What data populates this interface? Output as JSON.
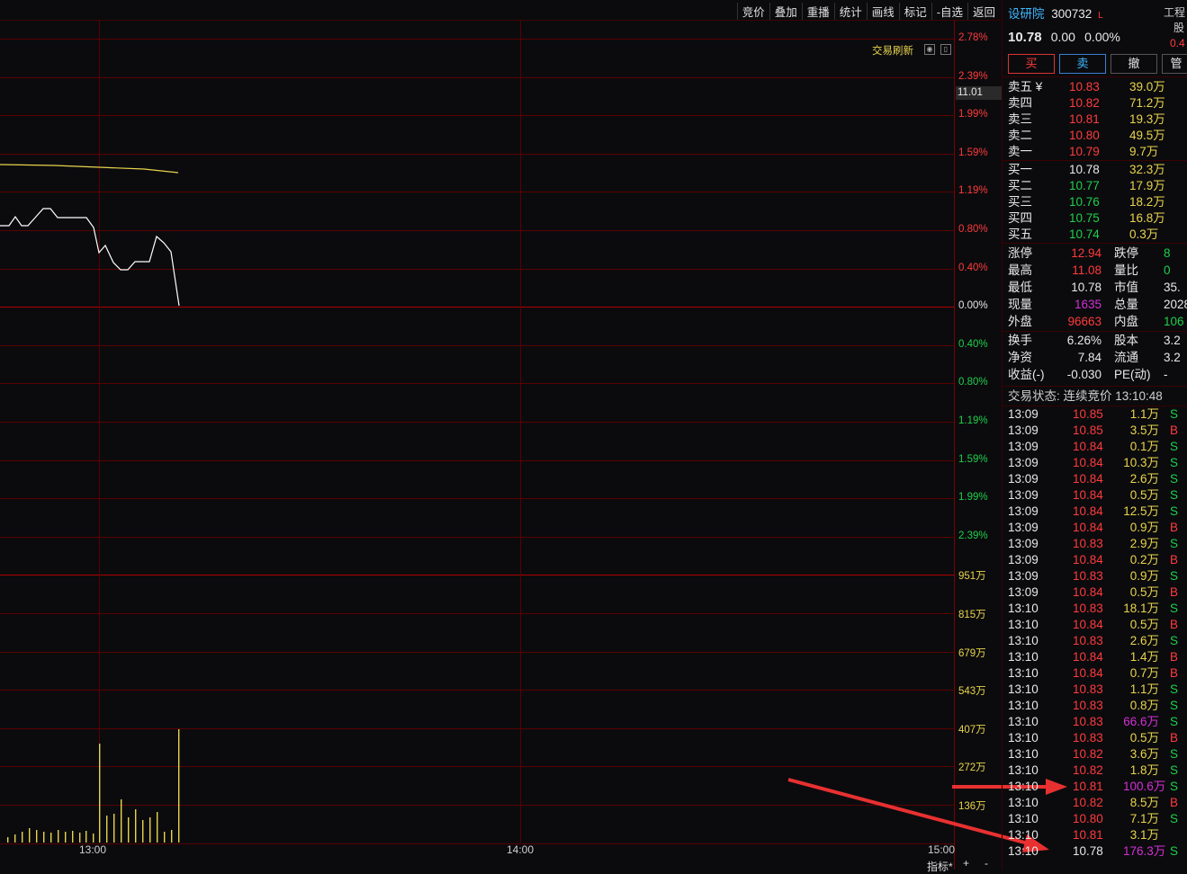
{
  "toolbar": {
    "buttons": [
      "竞价",
      "叠加",
      "重播",
      "统计",
      "画线",
      "标记",
      "-自选",
      "返回"
    ]
  },
  "chart": {
    "trade_refresh_label": "交易刷新",
    "price_tag": "11.01",
    "y_labels_up": [
      "2.78%",
      "2.39%",
      "1.99%",
      "1.59%",
      "1.19%",
      "0.80%",
      "0.40%"
    ],
    "y_label_zero": "0.00%",
    "y_labels_down": [
      "0.40%",
      "0.80%",
      "1.19%",
      "1.59%",
      "1.99%",
      "2.39%"
    ],
    "vol_labels": [
      "951万",
      "815万",
      "679万",
      "543万",
      "407万",
      "272万",
      "136万"
    ],
    "x_labels": [
      "13:00",
      "14:00",
      "15:00"
    ],
    "bottom_label": "指标*",
    "colors": {
      "grid": "#5a0000",
      "price_line": "#ffffff",
      "avg_line": "#e8d44c",
      "volume": "#e8d44c"
    }
  },
  "header": {
    "name": "设研院",
    "code": "300732",
    "flag": "L",
    "price": "10.78",
    "change": "0.00",
    "change_pct": "0.00%",
    "right_top_label": "工程",
    "right_sub_label": "股",
    "right_value": "0.4"
  },
  "actions": {
    "buy": "买",
    "sell": "卖",
    "cancel": "撤",
    "manage": "管"
  },
  "sell_book": [
    {
      "label": "卖五 ¥",
      "price": "10.83",
      "vol": "39.0万"
    },
    {
      "label": "卖四",
      "price": "10.82",
      "vol": "71.2万"
    },
    {
      "label": "卖三",
      "price": "10.81",
      "vol": "19.3万"
    },
    {
      "label": "卖二",
      "price": "10.80",
      "vol": "49.5万"
    },
    {
      "label": "卖一",
      "price": "10.79",
      "vol": "9.7万"
    }
  ],
  "buy_book": [
    {
      "label": "买一",
      "price": "10.78",
      "vol": "32.3万"
    },
    {
      "label": "买二",
      "price": "10.77",
      "vol": "17.9万"
    },
    {
      "label": "买三",
      "price": "10.76",
      "vol": "18.2万"
    },
    {
      "label": "买四",
      "price": "10.75",
      "vol": "16.8万"
    },
    {
      "label": "买五",
      "price": "10.74",
      "vol": "0.3万"
    }
  ],
  "stats1": [
    {
      "k1": "涨停",
      "v1": "12.94",
      "k2": "跌停",
      "v2": "8"
    },
    {
      "k1": "最高",
      "v1": "11.08",
      "k2": "量比",
      "v2": "0"
    },
    {
      "k1": "最低",
      "v1": "10.78",
      "k2": "市值",
      "v2": "35."
    },
    {
      "k1": "现量",
      "v1": "1635",
      "k2": "总量",
      "v2": "2028"
    },
    {
      "k1": "外盘",
      "v1": "96663",
      "k2": "内盘",
      "v2": "106"
    }
  ],
  "stats2": [
    {
      "k1": "换手",
      "v1": "6.26%",
      "k2": "股本",
      "v2": "3.2"
    },
    {
      "k1": "净资",
      "v1": "7.84",
      "k2": "流通",
      "v2": "3.2"
    },
    {
      "k1": "收益(-)",
      "v1": "-0.030",
      "k2": "PE(动)",
      "v2": "-"
    }
  ],
  "trade_status": "交易状态: 连续竞价 13:10:48",
  "ticks": [
    {
      "t": "13:09",
      "p": "10.85",
      "v": "1.1万",
      "s": "S"
    },
    {
      "t": "13:09",
      "p": "10.85",
      "v": "3.5万",
      "s": "B"
    },
    {
      "t": "13:09",
      "p": "10.84",
      "v": "0.1万",
      "s": "S"
    },
    {
      "t": "13:09",
      "p": "10.84",
      "v": "10.3万",
      "s": "S"
    },
    {
      "t": "13:09",
      "p": "10.84",
      "v": "2.6万",
      "s": "S"
    },
    {
      "t": "13:09",
      "p": "10.84",
      "v": "0.5万",
      "s": "S"
    },
    {
      "t": "13:09",
      "p": "10.84",
      "v": "12.5万",
      "s": "S"
    },
    {
      "t": "13:09",
      "p": "10.84",
      "v": "0.9万",
      "s": "B"
    },
    {
      "t": "13:09",
      "p": "10.83",
      "v": "2.9万",
      "s": "S"
    },
    {
      "t": "13:09",
      "p": "10.84",
      "v": "0.2万",
      "s": "B"
    },
    {
      "t": "13:09",
      "p": "10.83",
      "v": "0.9万",
      "s": "S"
    },
    {
      "t": "13:09",
      "p": "10.84",
      "v": "0.5万",
      "s": "B"
    },
    {
      "t": "13:10",
      "p": "10.83",
      "v": "18.1万",
      "s": "S"
    },
    {
      "t": "13:10",
      "p": "10.84",
      "v": "0.5万",
      "s": "B"
    },
    {
      "t": "13:10",
      "p": "10.83",
      "v": "2.6万",
      "s": "S"
    },
    {
      "t": "13:10",
      "p": "10.84",
      "v": "1.4万",
      "s": "B"
    },
    {
      "t": "13:10",
      "p": "10.84",
      "v": "0.7万",
      "s": "B"
    },
    {
      "t": "13:10",
      "p": "10.83",
      "v": "1.1万",
      "s": "S"
    },
    {
      "t": "13:10",
      "p": "10.83",
      "v": "0.8万",
      "s": "S"
    },
    {
      "t": "13:10",
      "p": "10.83",
      "v": "66.6万",
      "s": "S"
    },
    {
      "t": "13:10",
      "p": "10.83",
      "v": "0.5万",
      "s": "B"
    },
    {
      "t": "13:10",
      "p": "10.82",
      "v": "3.6万",
      "s": "S"
    },
    {
      "t": "13:10",
      "p": "10.82",
      "v": "1.8万",
      "s": "S"
    },
    {
      "t": "13:10",
      "p": "10.81",
      "v": "100.6万",
      "s": "S"
    },
    {
      "t": "13:10",
      "p": "10.82",
      "v": "8.5万",
      "s": "B"
    },
    {
      "t": "13:10",
      "p": "10.80",
      "v": "7.1万",
      "s": "S"
    },
    {
      "t": "13:10",
      "p": "10.81",
      "v": "3.1万",
      "s": ""
    },
    {
      "t": "13:10",
      "p": "10.78",
      "v": "176.3万",
      "s": "S"
    }
  ]
}
